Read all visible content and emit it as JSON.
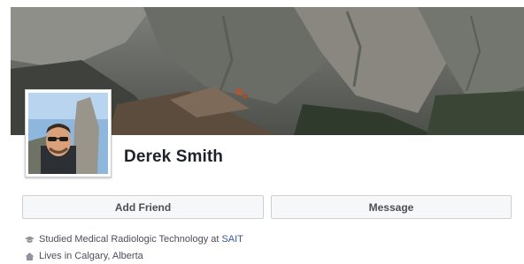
{
  "profile": {
    "name": "Derek Smith"
  },
  "actions": {
    "add_friend_label": "Add Friend",
    "message_label": "Message"
  },
  "about": {
    "education_prefix": "Studied Medical Radiologic Technology at",
    "education_link": "SAIT",
    "location_prefix": "Lives in",
    "location_link": "Calgary, Alberta"
  },
  "icons": {
    "education": "graduation-cap-icon",
    "location": "home-icon"
  },
  "colors": {
    "name_text": "#1d2129",
    "link": "#365899",
    "button_bg": "#f6f7f9",
    "button_border": "#ced0d4"
  }
}
